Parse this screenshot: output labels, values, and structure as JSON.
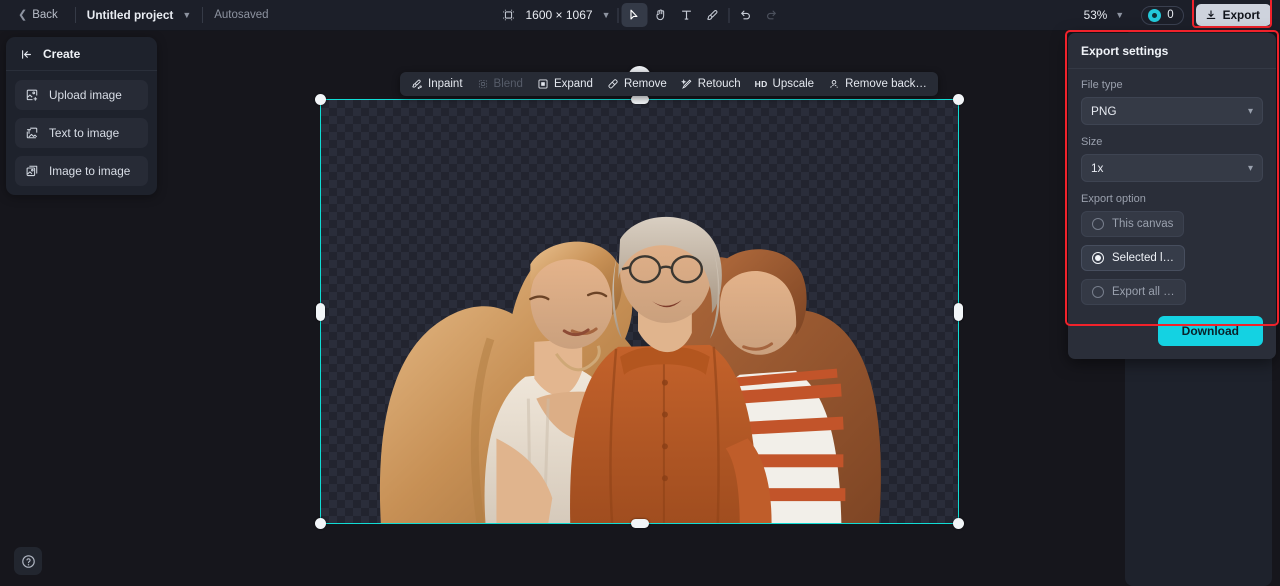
{
  "topbar": {
    "back_label": "Back",
    "project_name": "Untitled project",
    "autosaved_label": "Autosaved",
    "canvas_size": "1600 × 1067",
    "zoom_level": "53%",
    "credits_count": "0",
    "export_label": "Export",
    "tools": [
      {
        "name": "artboard-icon",
        "title": "Artboard"
      },
      {
        "name": "cursor-icon",
        "title": "Select",
        "active": true
      },
      {
        "name": "hand-icon",
        "title": "Pan"
      },
      {
        "name": "text-icon",
        "title": "Text"
      },
      {
        "name": "brush-icon",
        "title": "Brush"
      },
      {
        "name": "undo-icon",
        "title": "Undo"
      },
      {
        "name": "redo-icon",
        "title": "Redo",
        "disabled": true
      }
    ]
  },
  "create_panel": {
    "title": "Create",
    "items": [
      {
        "label": "Upload image",
        "icon": "upload-image-icon"
      },
      {
        "label": "Text to image",
        "icon": "text-to-image-icon"
      },
      {
        "label": "Image to image",
        "icon": "image-to-image-icon"
      }
    ]
  },
  "float_tools": [
    {
      "label": "Inpaint",
      "icon": "inpaint-icon",
      "disabled": false
    },
    {
      "label": "Blend",
      "icon": "blend-icon",
      "disabled": true
    },
    {
      "label": "Expand",
      "icon": "expand-icon",
      "disabled": false
    },
    {
      "label": "Remove",
      "icon": "remove-icon",
      "disabled": false
    },
    {
      "label": "Retouch",
      "icon": "retouch-icon",
      "disabled": false
    },
    {
      "label": "Upscale",
      "icon": "upscale-icon",
      "badge": "HD",
      "disabled": false
    },
    {
      "label": "Remove back…",
      "icon": "remove-background-icon",
      "disabled": false
    }
  ],
  "export_panel": {
    "title": "Export settings",
    "file_type_label": "File type",
    "file_type_value": "PNG",
    "size_label": "Size",
    "size_value": "1x",
    "export_option_label": "Export option",
    "options": [
      {
        "label": "This canvas",
        "selected": false
      },
      {
        "label": "Selected l…",
        "selected": true
      },
      {
        "label": "Export all …",
        "selected": false
      }
    ],
    "download_label": "Download"
  },
  "colors": {
    "accent_cyan": "#14d2e2",
    "selection_cyan": "#11dcd5",
    "highlight_red": "#f1222b",
    "panel_bg": "#1e222c",
    "canvas_bg": "#16161c"
  },
  "help": {
    "icon": "help-circle-icon"
  }
}
